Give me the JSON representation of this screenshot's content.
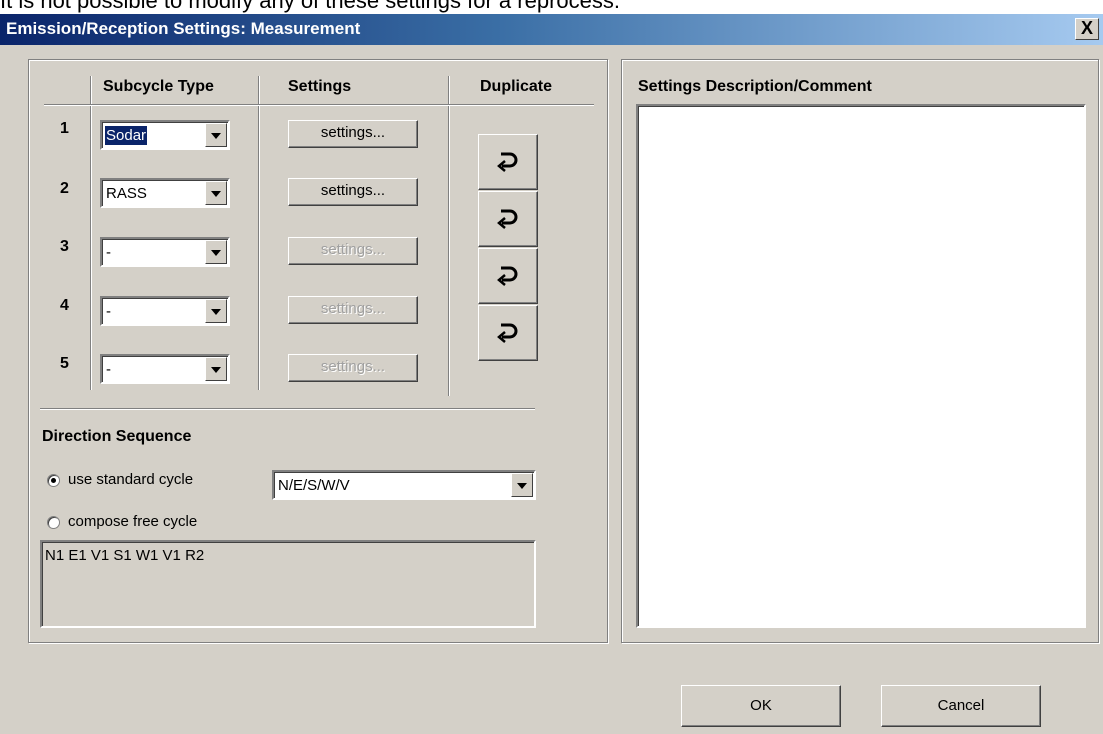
{
  "page_background_text": "It is not possible to modify any of these settings for a reprocess.",
  "window": {
    "title": "Emission/Reception Settings: Measurement",
    "close_label": "X"
  },
  "subcycles": {
    "headers": {
      "type": "Subcycle Type",
      "settings": "Settings",
      "duplicate": "Duplicate"
    },
    "rows": [
      {
        "num": "1",
        "type": "Sodar",
        "settings_label": "settings...",
        "enabled": true
      },
      {
        "num": "2",
        "type": "RASS",
        "settings_label": "settings...",
        "enabled": true
      },
      {
        "num": "3",
        "type": "-",
        "settings_label": "settings...",
        "enabled": false
      },
      {
        "num": "4",
        "type": "-",
        "settings_label": "settings...",
        "enabled": false
      },
      {
        "num": "5",
        "type": "-",
        "settings_label": "settings...",
        "enabled": false
      }
    ],
    "duplicate_icon": "duplicate-arrow-icon"
  },
  "direction": {
    "heading": "Direction Sequence",
    "standard_label": "use standard cycle",
    "standard_value": "N/E/S/W/V",
    "free_label": "compose free cycle",
    "free_value": "N1 E1 V1 S1 W1 V1 R2",
    "selected": "standard"
  },
  "description": {
    "heading": "Settings Description/Comment",
    "value": ""
  },
  "buttons": {
    "ok": "OK",
    "cancel": "Cancel"
  }
}
